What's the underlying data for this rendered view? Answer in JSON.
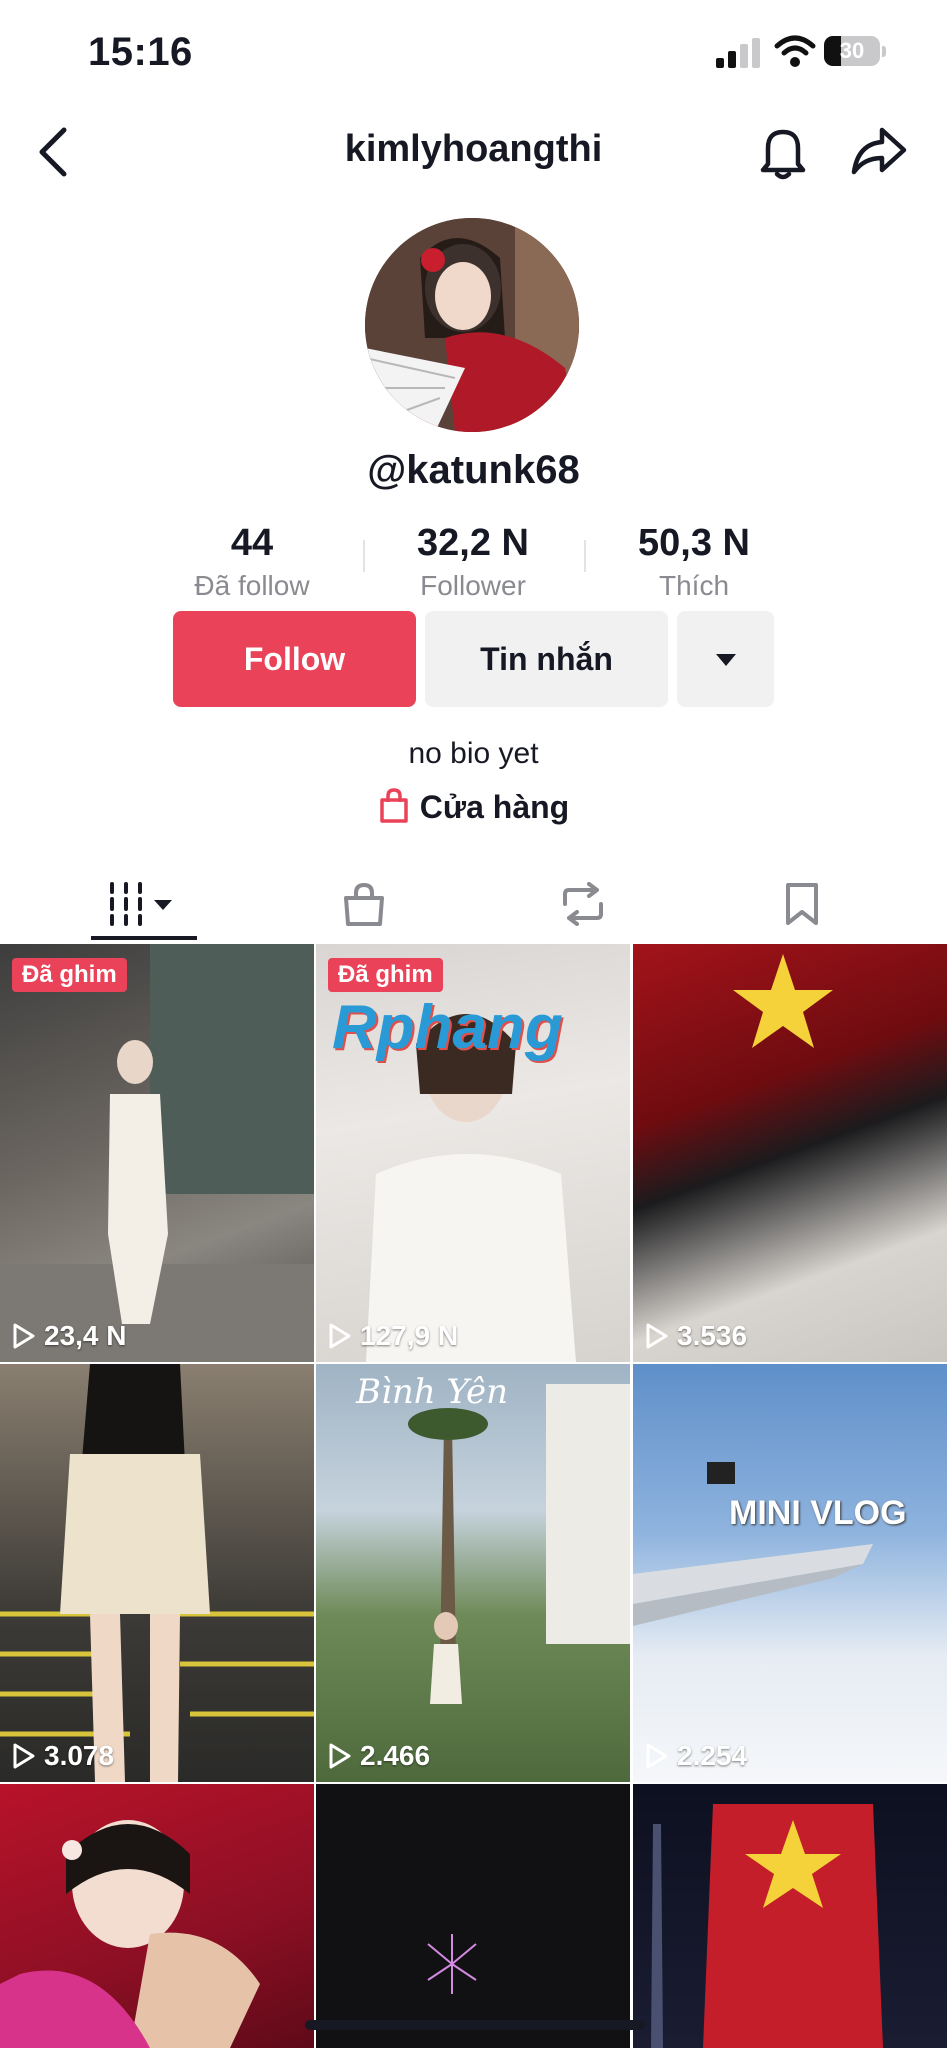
{
  "status_bar": {
    "time": "15:16",
    "battery": "30",
    "battery_level": 0.3
  },
  "header": {
    "title": "kimlyhoangthi"
  },
  "profile": {
    "username": "@katunk68",
    "bio": "no bio yet",
    "shop_label": "Cửa hàng"
  },
  "stats": [
    {
      "value": "44",
      "label": "Đã follow"
    },
    {
      "value": "32,2 N",
      "label": "Follower"
    },
    {
      "value": "50,3 N",
      "label": "Thích"
    }
  ],
  "actions": {
    "follow_label": "Follow",
    "message_label": "Tin nhắn"
  },
  "tabs": [
    "videos-grid-icon",
    "shop-bag-icon",
    "repost-icon",
    "bookmark-icon"
  ],
  "videos": [
    {
      "views": "23,4 N",
      "pinned_label": "Đã ghim"
    },
    {
      "views": "127,9 N",
      "pinned_label": "Đã ghim",
      "overlay_text": "Rphang"
    },
    {
      "views": "3.536"
    },
    {
      "views": "3.078"
    },
    {
      "views": "2.466",
      "overlay_text": "Bình Yên"
    },
    {
      "views": "2.254",
      "overlay_text": "MINI VLOG"
    },
    {
      "views": ""
    },
    {
      "views": ""
    },
    {
      "views": ""
    }
  ],
  "colors": {
    "accent": "#ea4359",
    "text": "#161823",
    "muted": "#8a8b91",
    "button_gray": "#f1f1f2"
  }
}
